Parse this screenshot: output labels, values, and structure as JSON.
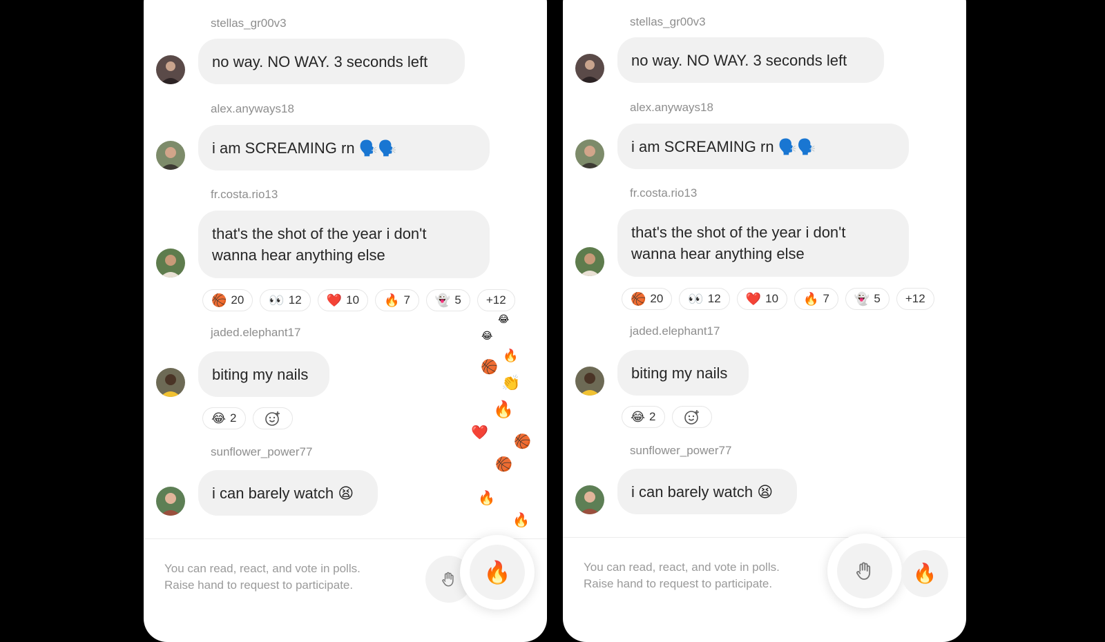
{
  "messages": [
    {
      "user": "stellas_gr00v3",
      "text": "no way. NO WAY. 3 seconds left"
    },
    {
      "user": "alex.anyways18",
      "text": "i am SCREAMING rn 🗣️🗣️"
    },
    {
      "user": "fr.costa.rio13",
      "line1": "that's the shot of the year i don't",
      "line2": "wanna hear anything else"
    },
    {
      "user": "jaded.elephant17",
      "text": "biting my nails"
    },
    {
      "user": "sunflower_power77",
      "text": "i can barely watch 😫"
    }
  ],
  "reactions_main": [
    {
      "emoji": "🏀",
      "count": "20"
    },
    {
      "emoji": "👀",
      "count": "12"
    },
    {
      "emoji": "❤️",
      "count": "10"
    },
    {
      "emoji": "🔥",
      "count": "7"
    },
    {
      "emoji": "👻",
      "count": "5"
    }
  ],
  "reactions_more": "+12",
  "reactions_small": [
    {
      "emoji": "😂",
      "count": "2"
    }
  ],
  "footer": {
    "line1": "You can read, react, and vote in polls.",
    "line2": "Raise hand to request to participate."
  },
  "icons": {
    "raise_hand": "raise-hand-icon",
    "fire": "fire-icon",
    "add_reaction": "add-reaction-icon"
  },
  "float_emojis": [
    "😂",
    "😂",
    "🔥",
    "🏀",
    "👏",
    "🔥",
    "❤️",
    "🏀",
    "🏀",
    "🔥",
    "🔥"
  ],
  "colors": {
    "bubble": "#f1f1f1",
    "username": "#8e8e8e",
    "text": "#262626",
    "background": "#000000"
  }
}
